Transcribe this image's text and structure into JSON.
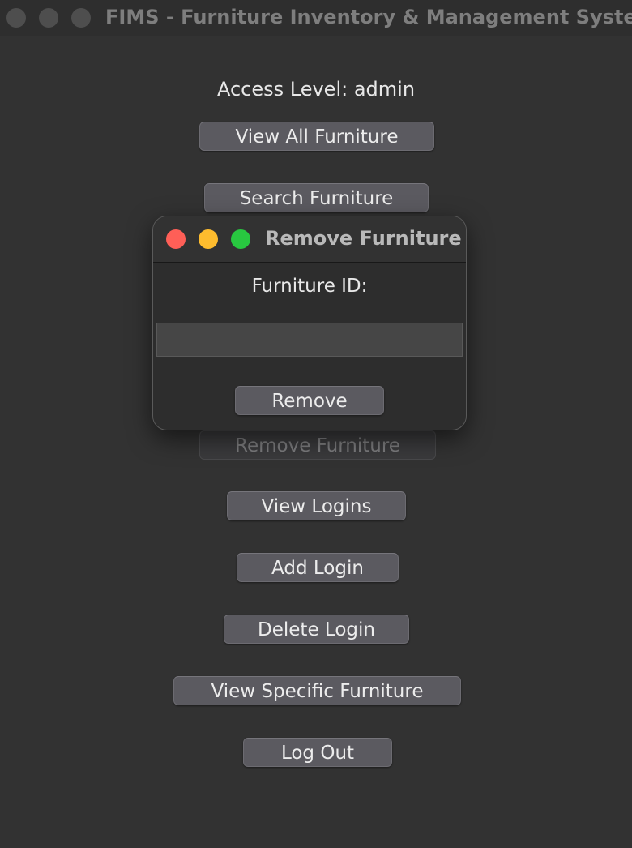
{
  "window": {
    "title": "FIMS - Furniture Inventory & Management System"
  },
  "main": {
    "access_level": "Access Level: admin",
    "buttons": {
      "view_all": "View All Furniture",
      "search": "Search Furniture",
      "remove": "Remove Furniture",
      "view_logins": "View Logins",
      "add_login": "Add Login",
      "delete_login": "Delete Login",
      "view_specific": "View Specific Furniture",
      "log_out": "Log Out"
    }
  },
  "dialog": {
    "title": "Remove Furniture",
    "field_label": "Furniture ID:",
    "field_value": "",
    "submit_label": "Remove"
  },
  "colors": {
    "close": "#fe5f57",
    "minimize": "#febc2e",
    "maximize": "#28c840"
  }
}
